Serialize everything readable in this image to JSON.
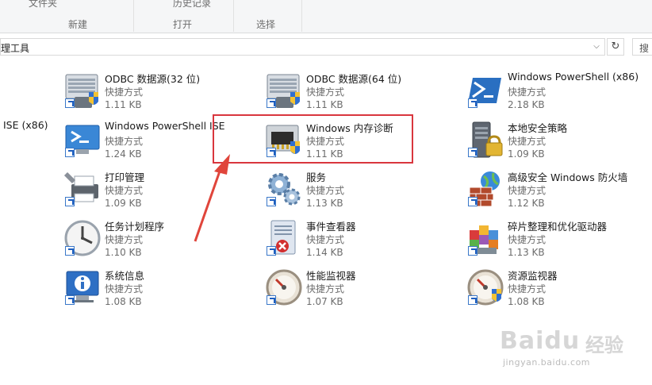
{
  "ribbon": {
    "top_left_text": "文件夹",
    "top_mid_text": "历史记录",
    "groups": [
      "新建",
      "打开",
      "选择"
    ]
  },
  "address": {
    "path": "理工具",
    "search_placeholder": "搜"
  },
  "partial_item": {
    "name": "ISE (x86)"
  },
  "items": [
    {
      "name": "ODBC 数据源(32 位)",
      "type": "快捷方式",
      "size": "1.11 KB",
      "icon": "odbc-icon"
    },
    {
      "name": "ODBC 数据源(64 位)",
      "type": "快捷方式",
      "size": "1.11 KB",
      "icon": "odbc-icon"
    },
    {
      "name": "Windows PowerShell (x86)",
      "type": "快捷方式",
      "size": "2.18 KB",
      "icon": "powershell-icon"
    },
    {
      "name": "Windows PowerShell ISE",
      "type": "快捷方式",
      "size": "1.24 KB",
      "icon": "powershell-ise-icon"
    },
    {
      "name": "Windows 内存诊断",
      "type": "快捷方式",
      "size": "1.11 KB",
      "icon": "memory-chip-icon"
    },
    {
      "name": "本地安全策略",
      "type": "快捷方式",
      "size": "1.09 KB",
      "icon": "server-lock-icon"
    },
    {
      "name": "打印管理",
      "type": "快捷方式",
      "size": "1.09 KB",
      "icon": "printer-icon"
    },
    {
      "name": "服务",
      "type": "快捷方式",
      "size": "1.13 KB",
      "icon": "gears-icon"
    },
    {
      "name": "高级安全 Windows 防火墙",
      "type": "快捷方式",
      "size": "1.12 KB",
      "icon": "firewall-icon"
    },
    {
      "name": "任务计划程序",
      "type": "快捷方式",
      "size": "1.10 KB",
      "icon": "clock-icon"
    },
    {
      "name": "事件查看器",
      "type": "快捷方式",
      "size": "1.14 KB",
      "icon": "event-log-icon"
    },
    {
      "name": "碎片整理和优化驱动器",
      "type": "快捷方式",
      "size": "1.13 KB",
      "icon": "defrag-icon"
    },
    {
      "name": "系统信息",
      "type": "快捷方式",
      "size": "1.08 KB",
      "icon": "info-monitor-icon"
    },
    {
      "name": "性能监视器",
      "type": "快捷方式",
      "size": "1.07 KB",
      "icon": "gauge-icon"
    },
    {
      "name": "资源监视器",
      "type": "快捷方式",
      "size": "1.08 KB",
      "icon": "gauge-icon"
    }
  ],
  "watermark": {
    "brand": "Baidu",
    "cn": "经验",
    "url": "jingyan.baidu.com"
  },
  "colors": {
    "highlight": "#d9363e",
    "secondary_text": "#6d6d6d"
  }
}
